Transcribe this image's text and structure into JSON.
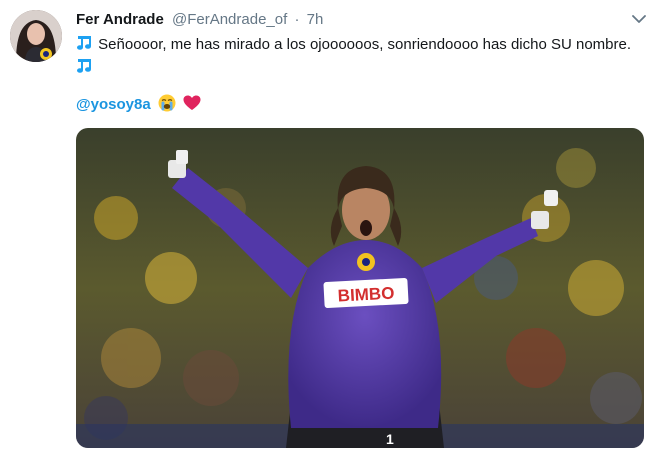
{
  "tweet": {
    "display_name": "Fer Andrade",
    "handle": "@FerAndrade_of",
    "separator": "·",
    "time": "7h",
    "text": "Señoooor, me has mirado a los ojoooooos, sonriendoooo has dicho SU nombre.",
    "mention": "@yosoy8a",
    "emoji": [
      "loudly-crying-face",
      "red-heart"
    ],
    "photo": {
      "jersey_sponsor": "BIMBO",
      "jersey_number": "1",
      "jersey_color": "#5b3fa6"
    }
  },
  "colors": {
    "name": "#14171a",
    "secondary": "#657786",
    "link": "#1b95e0",
    "note": "#1da1f2"
  },
  "icons": {
    "menu": "chevron-down-icon",
    "note": "musical-notes-icon"
  }
}
